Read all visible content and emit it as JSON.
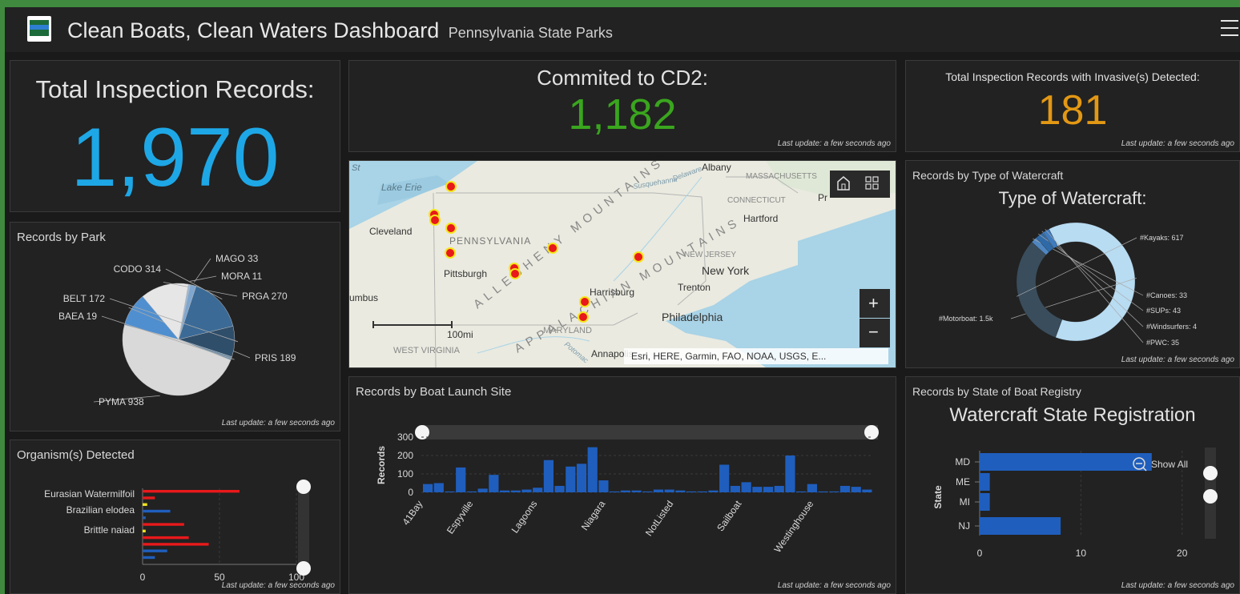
{
  "header": {
    "title": "Clean Boats, Clean Waters Dashboard",
    "subtitle": "Pennsylvania State Parks"
  },
  "last_update": "Last update: a few seconds ago",
  "indicators": {
    "total": {
      "label": "Total Inspection Records:",
      "value": "1,970",
      "color": "#1ea7e6"
    },
    "cd2": {
      "label": "Commited to CD2:",
      "value": "1,182",
      "color": "#3aa51e"
    },
    "invasive": {
      "label": "Total Inspection Records with Invasive(s) Detected:",
      "value": "181",
      "color": "#e39814"
    }
  },
  "map": {
    "attribution": "Esri, HERE, Garmin, FAO, NOAA, USGS, E...",
    "scale": "100mi",
    "places": [
      "Albany",
      "MASSACHUSETTS",
      "Lake Erie",
      "Susquehanna",
      "Delaware",
      "CONNECTICUT",
      "Hartford",
      "Cleveland",
      "PENNSYLVANIA",
      "NEW JERSEY",
      "New York",
      "Pittsburgh",
      "Harrisburg",
      "Trenton",
      "Philadelphia",
      "MARYLAND",
      "Annapolis",
      "WEST VIRGINIA",
      "umbus",
      "Potomac"
    ],
    "zoom_in": "+",
    "zoom_out": "−"
  },
  "records_by_park": {
    "title": "Records by Park",
    "chart_data": {
      "type": "pie",
      "slices": [
        {
          "label": "PYMA",
          "value": 938,
          "color": "#d9d9d9"
        },
        {
          "label": "PRIS",
          "value": 189,
          "color": "#4f8fd0"
        },
        {
          "label": "PRGA",
          "value": 270,
          "color": "#e6e6e6"
        },
        {
          "label": "MORA",
          "value": 11,
          "color": "#9ab7d6"
        },
        {
          "label": "MAGO",
          "value": 33,
          "color": "#7ea6cf"
        },
        {
          "label": "CODO",
          "value": 314,
          "color": "#3b6a96"
        },
        {
          "label": "BELT",
          "value": 172,
          "color": "#2f4e6a"
        },
        {
          "label": "BAEA",
          "value": 19,
          "color": "#6e8ea8"
        }
      ]
    }
  },
  "organisms": {
    "title": "Organism(s) Detected",
    "chart_data": {
      "type": "bar",
      "orientation": "horizontal",
      "categories": [
        "Eurasian Watermilfoil",
        "Brazilian elodea",
        "Brittle naiad"
      ],
      "bars": [
        {
          "value": 63,
          "color": "#e8191b"
        },
        {
          "value": 8,
          "color": "#e8191b"
        },
        {
          "value": 3,
          "color": "#f0e11a"
        },
        {
          "value": 18,
          "color": "#1f5ebd"
        },
        {
          "value": 2,
          "color": "#1f5ebd"
        },
        {
          "value": 27,
          "color": "#e8191b"
        },
        {
          "value": 2,
          "color": "#f0e11a"
        },
        {
          "value": 30,
          "color": "#e8191b"
        },
        {
          "value": 43,
          "color": "#e8191b"
        },
        {
          "value": 16,
          "color": "#1f5ebd"
        },
        {
          "value": 8,
          "color": "#1f5ebd"
        }
      ],
      "xticks": [
        "0",
        "50",
        "100"
      ],
      "xlim": [
        0,
        100
      ]
    }
  },
  "launch_site": {
    "title": "Records by Boat Launch Site",
    "chart_data": {
      "type": "bar",
      "ylabel": "Records",
      "yticks": [
        "0",
        "100",
        "200",
        "300"
      ],
      "ylim": [
        0,
        300
      ],
      "xlabels": [
        "41Bay",
        "Espyville",
        "Lagoons",
        "Niagara",
        "NotListed",
        "Sailboat",
        "Westinghouse"
      ],
      "values": [
        45,
        50,
        5,
        135,
        5,
        20,
        95,
        10,
        10,
        15,
        25,
        175,
        35,
        140,
        155,
        245,
        65,
        5,
        10,
        10,
        5,
        15,
        15,
        10,
        5,
        5,
        10,
        150,
        35,
        55,
        30,
        30,
        35,
        200,
        5,
        45,
        5,
        5,
        35,
        30,
        15
      ],
      "color": "#1f5ebd"
    }
  },
  "watercraft": {
    "title": "Records by Type of Watercraft",
    "heading": "Type of Watercraft:",
    "chart_data": {
      "type": "pie",
      "slices": [
        {
          "label": "#Motorboat: 1.5k",
          "value": 1250,
          "color": "#b8dcf2"
        },
        {
          "label": "#Kayaks: 617",
          "value": 617,
          "color": "#3a4d5c"
        },
        {
          "label": "#Canoes: 33",
          "value": 33,
          "color": "#4f86c0"
        },
        {
          "label": "#SUPs: 43",
          "value": 43,
          "color": "#2f6aa8"
        },
        {
          "label": "#Windsurfers: 4",
          "value": 4,
          "color": "#7fb2e0"
        },
        {
          "label": "#PWC: 35",
          "value": 35,
          "color": "#3f7bbf"
        }
      ]
    }
  },
  "state_registry": {
    "title": "Records by State of Boat Registry",
    "heading": "Watercraft State Registration",
    "show_all": "Show All",
    "chart_data": {
      "type": "bar",
      "orientation": "horizontal",
      "ylabel": "State",
      "categories": [
        "MD",
        "ME",
        "MI",
        "NJ"
      ],
      "values": [
        17,
        1,
        1,
        8
      ],
      "xticks": [
        "0",
        "10",
        "20"
      ],
      "xlim": [
        0,
        22
      ],
      "color": "#1f5ebd"
    }
  }
}
